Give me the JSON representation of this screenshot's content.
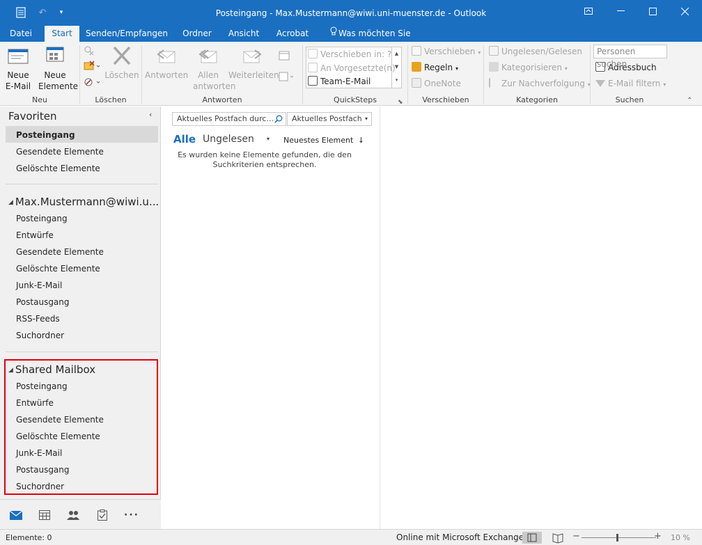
{
  "window": {
    "title": "Posteingang - Max.Mustermann@wiwi.uni-muenster.de - Outlook"
  },
  "ribbon_tabs": [
    {
      "label": "Datei"
    },
    {
      "label": "Start"
    },
    {
      "label": "Senden/Empfangen"
    },
    {
      "label": "Ordner"
    },
    {
      "label": "Ansicht"
    },
    {
      "label": "Acrobat"
    },
    {
      "label": "Was möchten Sie tun?"
    }
  ],
  "ribbon": {
    "neu": {
      "new_email": "Neue E-Mail",
      "new_items": "Neue Elemente",
      "label": "Neu"
    },
    "loeschen": {
      "delete": "Löschen",
      "label": "Löschen"
    },
    "antworten": {
      "reply": "Antworten",
      "reply_all": "Allen antworten",
      "forward": "Weiterleiten",
      "label": "Antworten"
    },
    "quicksteps": {
      "items": [
        "Verschieben in: ?",
        "An Vorgesetzte(n)",
        "Team-E-Mail"
      ],
      "label": "QuickSteps"
    },
    "verschieben": {
      "move": "Verschieben",
      "rules": "Regeln",
      "onenote": "OneNote",
      "label": "Verschieben"
    },
    "kategorien": {
      "unread_read": "Ungelesen/Gelesen",
      "categorize": "Kategorisieren",
      "follow_up": "Zur Nachverfolgung",
      "label": "Kategorien"
    },
    "suchen": {
      "people_placeholder": "Personen suchen",
      "address_book": "Adressbuch",
      "filter_email": "E-Mail filtern",
      "label": "Suchen"
    }
  },
  "nav": {
    "favorites": {
      "header": "Favoriten",
      "items": [
        "Posteingang",
        "Gesendete Elemente",
        "Gelöschte Elemente"
      ]
    },
    "account": {
      "header": "Max.Mustermann@wiwi.u...",
      "items": [
        "Posteingang",
        "Entwürfe",
        "Gesendete Elemente",
        "Gelöschte Elemente",
        "Junk-E-Mail",
        "Postausgang",
        "RSS-Feeds",
        "Suchordner"
      ]
    },
    "shared": {
      "header": "Shared Mailbox",
      "items": [
        "Posteingang",
        "Entwürfe",
        "Gesendete Elemente",
        "Gelöschte Elemente",
        "Junk-E-Mail",
        "Postausgang",
        "Suchordner"
      ]
    }
  },
  "message_list": {
    "search_placeholder": "Aktuelles Postfach durc...",
    "scope": "Aktuelles Postfach",
    "filter_all": "Alle",
    "filter_unread": "Ungelesen",
    "sort": "Neuestes Element",
    "empty_text": "Es wurden keine Elemente gefunden, die den Suchkriterien entsprechen."
  },
  "statusbar": {
    "items_count": "Elemente: 0",
    "connection": "Online mit Microsoft Exchange",
    "zoom": "10 %"
  },
  "colors": {
    "accent": "#1a6fc1",
    "highlight_border": "#e3000f"
  }
}
